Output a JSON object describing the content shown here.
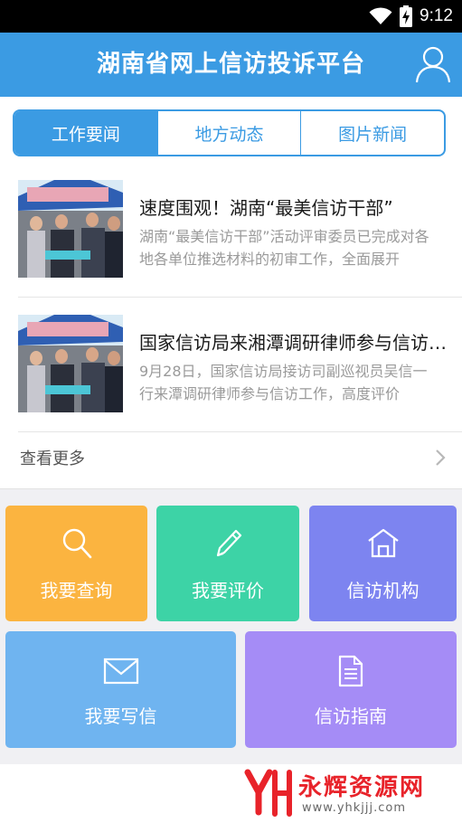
{
  "status_bar": {
    "time": "9:12"
  },
  "app_bar": {
    "title": "湖南省网上信访投诉平台"
  },
  "tabs": [
    {
      "label": "工作要闻",
      "active": true
    },
    {
      "label": "地方动态",
      "active": false
    },
    {
      "label": "图片新闻",
      "active": false
    }
  ],
  "news": [
    {
      "title": "速度围观！湖南“最美信访干部”",
      "summary": "湖南“最美信访干部”活动评审委员已完成对各地各单位推选材料的初审工作，全面展开"
    },
    {
      "title": "国家信访局来湘潭调研律师参与信访工作",
      "summary": "9月28日，国家信访局接访司副巡视员吴信一行来潭调研律师参与信访工作，高度评价"
    }
  ],
  "more": {
    "label": "查看更多"
  },
  "actions": [
    {
      "label": "我要查询",
      "icon": "search-icon",
      "color": "#fbb440"
    },
    {
      "label": "我要评价",
      "icon": "pen-icon",
      "color": "#3dd3a6"
    },
    {
      "label": "信访机构",
      "icon": "house-icon",
      "color": "#7d84f0"
    },
    {
      "label": "我要写信",
      "icon": "mail-icon",
      "color": "#6fb4f0"
    },
    {
      "label": "信访指南",
      "icon": "document-icon",
      "color": "#a58cf6"
    }
  ],
  "watermark": {
    "name": "永辉资源网",
    "url": "www.yhkjjj.com"
  },
  "colors": {
    "primary": "#3b9be3"
  }
}
